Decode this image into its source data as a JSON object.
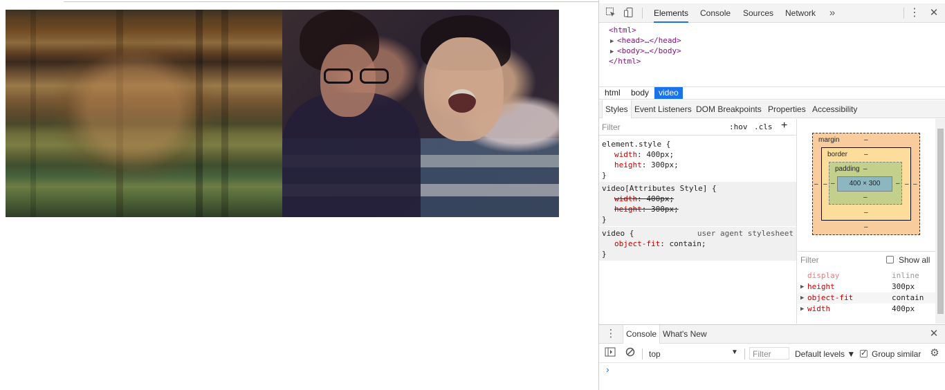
{
  "devtools": {
    "main_tabs": [
      "Elements",
      "Console",
      "Sources",
      "Network"
    ],
    "more_tabs_icon": "chevron-double-right-icon",
    "dom": {
      "html_open": "<html>",
      "head": "<head>…</head>",
      "body": "<body>…</body>",
      "html_close": "</html>"
    },
    "breadcrumbs": [
      "html",
      "body",
      "video"
    ],
    "sub_tabs": [
      "Styles",
      "Event Listeners",
      "DOM Breakpoints",
      "Properties",
      "Accessibility"
    ],
    "styles": {
      "filter_placeholder": "Filter",
      "hov": ":hov",
      "cls": ".cls",
      "add": "+",
      "rules": [
        {
          "selector": "element.style {",
          "props": [
            {
              "name": "width",
              "value": "400px;"
            },
            {
              "name": "height",
              "value": "300px;"
            }
          ],
          "close": "}"
        },
        {
          "selector": "video[Attributes Style] {",
          "props": [
            {
              "name": "width",
              "value": "400px;"
            },
            {
              "name": "height",
              "value": "300px;"
            }
          ],
          "close": "}"
        },
        {
          "selector": "video {",
          "origin": "user agent stylesheet",
          "props": [
            {
              "name": "object-fit",
              "value": "contain;"
            }
          ],
          "close": "}"
        }
      ]
    },
    "box_model": {
      "margin_label": "margin",
      "border_label": "border",
      "padding_label": "padding",
      "content": "400 × 300",
      "dash": "–"
    },
    "computed": {
      "filter_placeholder": "Filter",
      "show_all": "Show all",
      "rows": [
        {
          "name": "display",
          "value": "inline"
        },
        {
          "name": "height",
          "value": "300px"
        },
        {
          "name": "object-fit",
          "value": "contain"
        },
        {
          "name": "width",
          "value": "400px"
        }
      ]
    },
    "drawer": {
      "tabs": [
        "Console",
        "What's New"
      ],
      "context": "top",
      "filter_placeholder": "Filter",
      "levels": "Default levels ▼",
      "group_similar": "Group similar",
      "prompt": "›"
    }
  }
}
